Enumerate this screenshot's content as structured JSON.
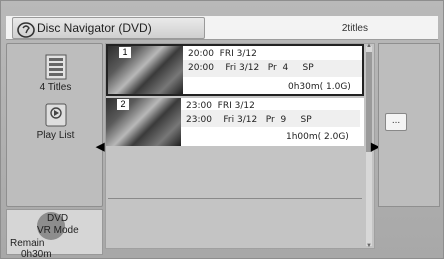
{
  "header": {
    "title": "Disc Navigator (DVD)",
    "title_count": "2titles"
  },
  "sidebar": {
    "titles_label": "4 Titles",
    "playlist_label": "Play List"
  },
  "mode": {
    "line1": "DVD",
    "line2": "VR Mode",
    "remain_label": "Remain",
    "remain_value": "0h30m"
  },
  "titles": [
    {
      "number": "1",
      "line1": "20:00  FRI 3/12",
      "line2": "20:00    Fri 3/12   Pr  4     SP",
      "duration": "0h30m( 1.0G)"
    },
    {
      "number": "2",
      "line1": "23:00  FRI 3/12",
      "line2": "23:00    Fri 3/12   Pr  9     SP",
      "duration": "1h00m( 2.0G)"
    }
  ],
  "right_panel": {
    "more_label": "..."
  },
  "colors": {
    "frame": "#b0b0b0",
    "selected_border": "#222222"
  }
}
